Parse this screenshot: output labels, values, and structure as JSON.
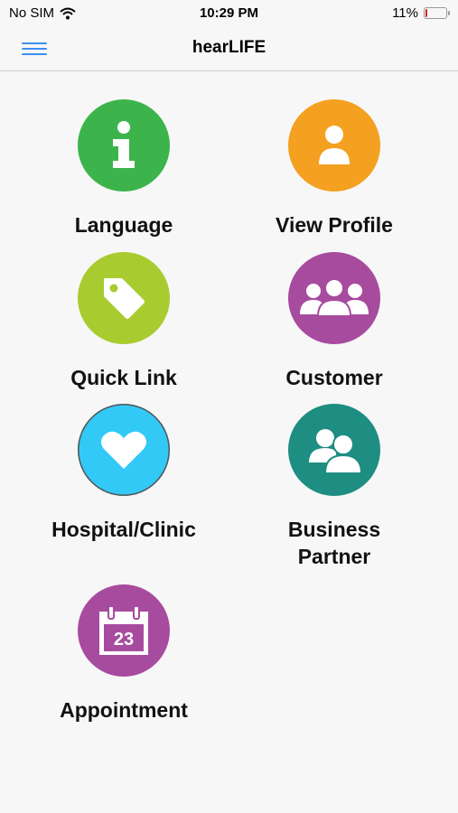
{
  "status": {
    "carrier": "No SIM",
    "time": "10:29 PM",
    "battery": "11%",
    "battery_level": 0.11
  },
  "nav": {
    "title": "hearLIFE"
  },
  "tiles": [
    {
      "label": "Language",
      "color": "#3cb44b",
      "icon": "info-icon"
    },
    {
      "label": "View Profile",
      "color": "#f4a020",
      "icon": "person-icon"
    },
    {
      "label": "Quick Link",
      "color": "#a8cc30",
      "icon": "tag-icon"
    },
    {
      "label": "Customer",
      "color": "#a74b9e",
      "icon": "group-icon"
    },
    {
      "label": "Hospital/Clinic",
      "color": "#33c9f7",
      "icon": "heart-icon"
    },
    {
      "label": "Business\nPartner",
      "color": "#1e8d82",
      "icon": "partners-icon"
    },
    {
      "label": "Appointment",
      "color": "#a74b9e",
      "icon": "calendar-icon",
      "calendar_day": "23"
    }
  ]
}
